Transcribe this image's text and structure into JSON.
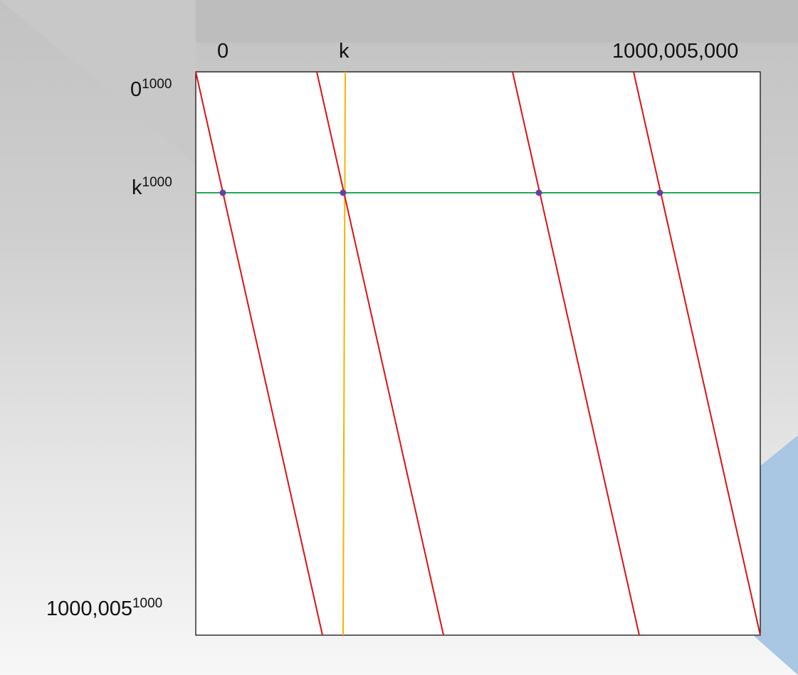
{
  "top_labels": {
    "start": "0",
    "k": "k",
    "end": "1000,005,000"
  },
  "left_labels": {
    "start_base": "0",
    "start_exp": "1000",
    "k_base": "k",
    "k_exp": "1000",
    "end_base": "1000,005",
    "end_exp": "1000"
  },
  "colors": {
    "red_lines": "#dd1111",
    "vertical_line": "#f5b400",
    "horizontal_line": "#22aa55",
    "dots": "#6a3fa0",
    "box_border": "#000000",
    "accent_corner": "#a9c6e3"
  },
  "diagram": {
    "red_line_count": 4,
    "intersection_count": 4
  }
}
